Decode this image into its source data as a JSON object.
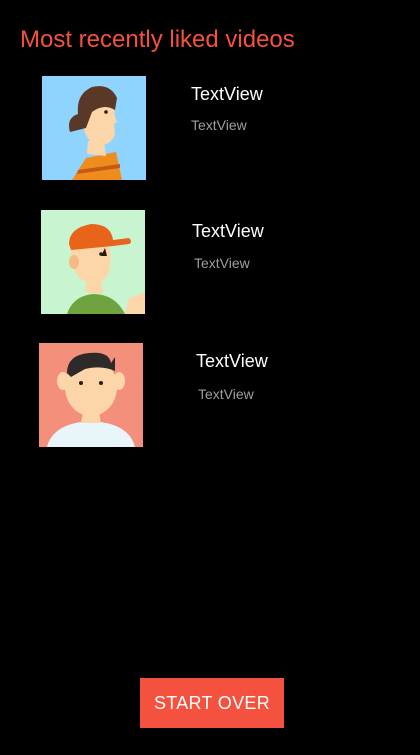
{
  "header": {
    "title": "Most recently liked videos",
    "title_color": "#f4513f"
  },
  "videos": [
    {
      "title": "TextView",
      "subtitle": "TextView",
      "avatar_icon": "woman-brown-hair-avatar-icon",
      "avatar_bg": "#8fd3ff"
    },
    {
      "title": "TextView",
      "subtitle": "TextView",
      "avatar_icon": "man-orange-cap-avatar-icon",
      "avatar_bg": "#c8f5cf"
    },
    {
      "title": "TextView",
      "subtitle": "TextView",
      "avatar_icon": "boy-dark-hair-avatar-icon",
      "avatar_bg": "#f48f7c"
    }
  ],
  "footer": {
    "button_label": "START OVER",
    "button_color": "#f4513f"
  }
}
